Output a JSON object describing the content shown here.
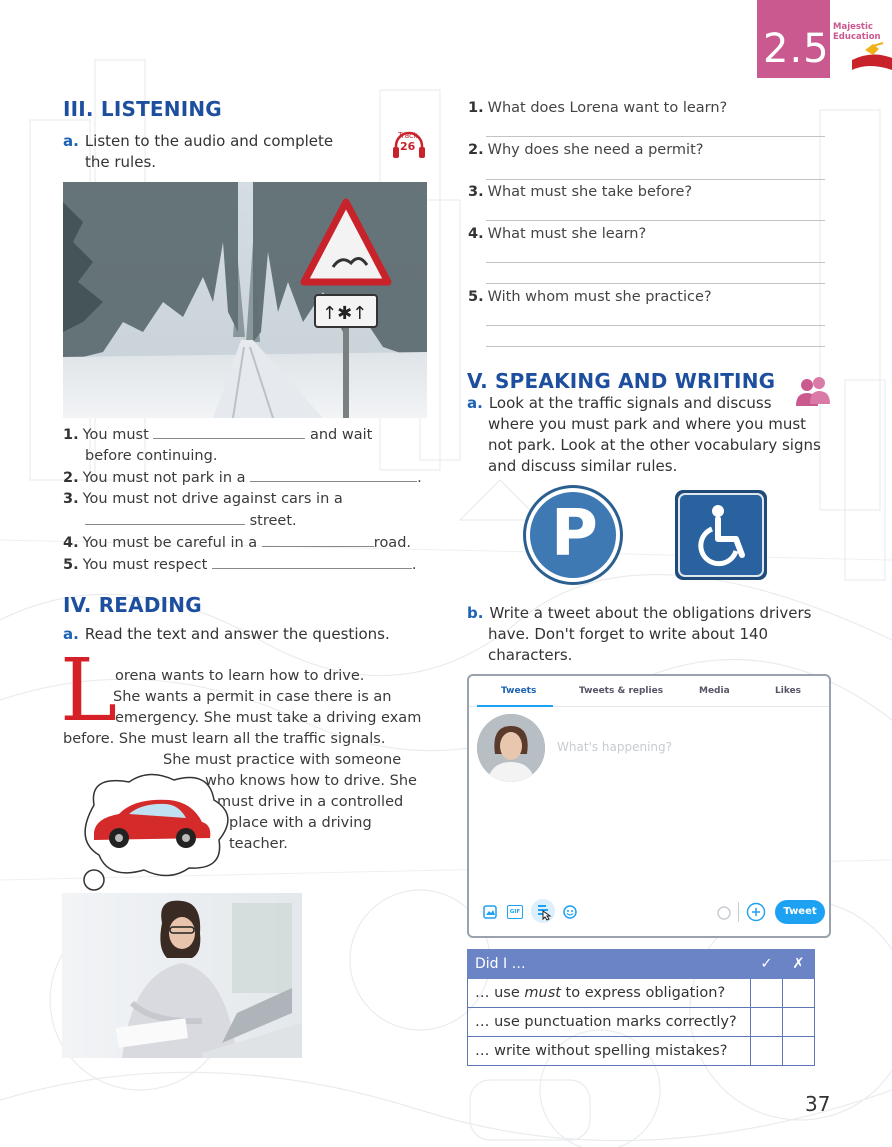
{
  "header": {
    "section_number": "2.5",
    "brand_line1": "Majestic",
    "brand_line2": "Education"
  },
  "listening": {
    "title": "III. LISTENING",
    "instruction_letter": "a.",
    "instruction_line1": "Listen to the audio and complete",
    "instruction_line2": "the rules.",
    "track_label": "Track",
    "track_number": "26",
    "rules": [
      {
        "num": "1.",
        "pre": "You must",
        "post": "and wait",
        "cont": "before continuing."
      },
      {
        "num": "2.",
        "pre": "You must not park in a",
        "post": "."
      },
      {
        "num": "3.",
        "pre": "You must not drive against cars in a",
        "cont": "street."
      },
      {
        "num": "4.",
        "pre": "You must be careful in a",
        "post": "road."
      },
      {
        "num": "5.",
        "pre": "You must respect",
        "post": "."
      }
    ]
  },
  "reading": {
    "title": "IV. READING",
    "instruction_letter": "a.",
    "instruction": "Read the text and answer the questions.",
    "drop_cap": "L",
    "lines": [
      "orena wants to learn how to drive.",
      "She wants a permit in case there is an",
      "emergency. She must take a driving exam",
      "before. She must learn all the traffic signals.",
      "She must practice with someone",
      "who knows how to drive. She",
      "must drive in a controlled",
      "place with a driving",
      "teacher."
    ]
  },
  "questions": [
    {
      "num": "1.",
      "text": "What does Lorena want to learn?"
    },
    {
      "num": "2.",
      "text": "Why does she need a permit?"
    },
    {
      "num": "3.",
      "text": "What must she take before?"
    },
    {
      "num": "4.",
      "text": "What must she learn?"
    },
    {
      "num": "5.",
      "text": "With whom must she practice?"
    }
  ],
  "speaking": {
    "title": "V. SPEAKING AND WRITING",
    "a_letter": "a.",
    "a_lines": [
      "Look at the traffic signals and discuss",
      "where you must park and where you must",
      "not park. Look at the other vocabulary signs",
      "and discuss similar rules."
    ],
    "parking_letter": "P",
    "b_letter": "b.",
    "b_lines": [
      "Write a tweet about the obligations drivers",
      "have. Don't forget to write about 140",
      "characters."
    ]
  },
  "tweet": {
    "tabs": [
      "Tweets",
      "Tweets & replies",
      "Media",
      "Likes"
    ],
    "placeholder": "What's happening?",
    "button": "Tweet",
    "gif_label": "GIF",
    "accent": "#1da1f2"
  },
  "checklist": {
    "header": "Did I …",
    "check_symbol": "✓",
    "cross_symbol": "✗",
    "rows": [
      {
        "pre": "… use ",
        "em": "must",
        "post": "  to express obligation?"
      },
      {
        "pre": "… use punctuation marks correctly?",
        "em": "",
        "post": ""
      },
      {
        "pre": "… write without spelling mistakes?",
        "em": "",
        "post": ""
      }
    ],
    "header_color": "#6b84c6"
  },
  "page_number": "37"
}
